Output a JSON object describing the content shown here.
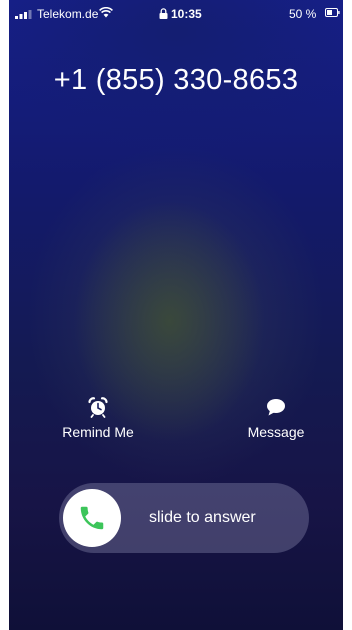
{
  "status_bar": {
    "carrier": "Telekom.de",
    "time": "10:35",
    "battery_percent": "50 %",
    "signal_icon": "signal-bars-icon",
    "wifi_icon": "wifi-icon",
    "lock_icon": "lock-icon",
    "battery_icon": "battery-icon"
  },
  "call": {
    "caller_number": "+1 (855) 330-8653"
  },
  "actions": {
    "remind": {
      "label": "Remind Me",
      "icon": "alarm-clock-icon"
    },
    "message": {
      "label": "Message",
      "icon": "speech-bubble-icon"
    }
  },
  "slider": {
    "label": "slide to answer",
    "icon": "phone-icon"
  },
  "colors": {
    "accept_green": "#3cc55a",
    "background_top": "#161f8a",
    "background_bottom": "#0f1038"
  }
}
